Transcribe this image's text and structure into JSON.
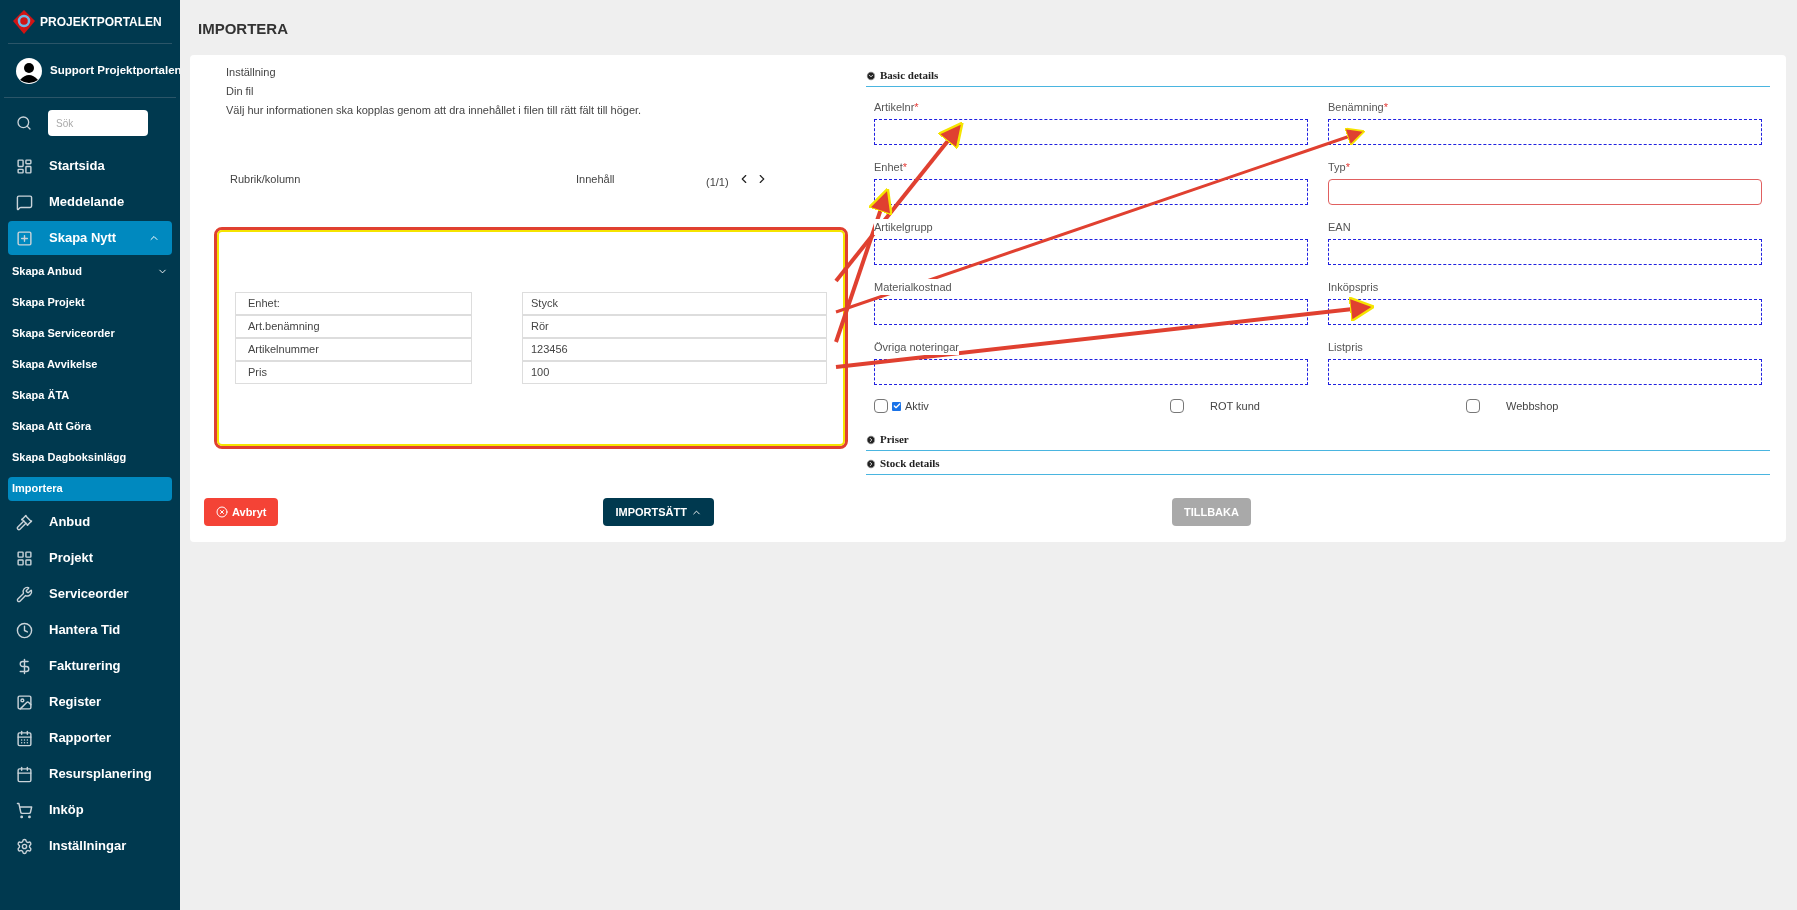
{
  "sidebar": {
    "brand": "PROJEKTPORTALEN",
    "user": "Support Projektportalen",
    "search": {
      "placeholder": "Sök"
    },
    "items": [
      {
        "label": "Startsida",
        "selected": false
      },
      {
        "label": "Meddelande",
        "selected": false
      },
      {
        "label": "Skapa Nytt",
        "selected": true,
        "expanded": true,
        "children": [
          {
            "label": "Skapa Anbud",
            "selected": false,
            "expanded": false
          },
          {
            "label": "Skapa Projekt",
            "selected": false
          },
          {
            "label": "Skapa Serviceorder",
            "selected": false
          },
          {
            "label": "Skapa Avvikelse",
            "selected": false
          },
          {
            "label": "Skapa ÄTA",
            "selected": false
          },
          {
            "label": "Skapa Att Göra",
            "selected": false
          },
          {
            "label": "Skapa Dagboksinlägg",
            "selected": false
          },
          {
            "label": "Importera",
            "selected": true
          }
        ]
      },
      {
        "label": "Anbud",
        "selected": false
      },
      {
        "label": "Projekt",
        "selected": false
      },
      {
        "label": "Serviceorder",
        "selected": false
      },
      {
        "label": "Hantera Tid",
        "selected": false
      },
      {
        "label": "Fakturering",
        "selected": false
      },
      {
        "label": "Register",
        "selected": false
      },
      {
        "label": "Rapporter",
        "selected": false
      },
      {
        "label": "Resursplanering",
        "selected": false
      },
      {
        "label": "Inköp",
        "selected": false
      },
      {
        "label": "Inställningar",
        "selected": false
      }
    ]
  },
  "page_title": "IMPORTERA",
  "intro": [
    "Inställning",
    "Din fil",
    "Välj hur informationen ska kopplas genom att dra innehållet i filen till rätt fält till höger."
  ],
  "mapping": {
    "column_heading": "Rubrik/kolumn",
    "content_heading": "Innehåll",
    "pager": "(1/1)",
    "rows": [
      {
        "heading": "Enhet:",
        "content": "Styck"
      },
      {
        "heading": "Art.benämning",
        "content": "Rör"
      },
      {
        "heading": "Artikelnummer",
        "content": "123456"
      },
      {
        "heading": "Pris",
        "content": "100"
      }
    ]
  },
  "sections": [
    {
      "title": "Basic details",
      "expanded": true,
      "fields": [
        {
          "label": "Artikelnr",
          "required_mark": "*",
          "error": false
        },
        {
          "label": "Benämning",
          "required_mark": "*",
          "error": false
        },
        {
          "label": "Enhet",
          "required_mark": "*",
          "error": false
        },
        {
          "label": "Typ",
          "required_mark": "*",
          "error": true
        },
        {
          "label": "Artikelgrupp",
          "error": false
        },
        {
          "label": "EAN",
          "error": false
        },
        {
          "label": "Materialkostnad",
          "error": false
        },
        {
          "label": "Inköpspris",
          "error": false
        },
        {
          "label": "Övriga noteringar",
          "error": false
        },
        {
          "label": "Listpris",
          "error": false
        }
      ],
      "checkboxes": [
        {
          "label": "Aktiv",
          "checked": false,
          "inner_checked": true
        },
        {
          "label": "ROT kund",
          "checked": false
        },
        {
          "label": "Webbshop",
          "checked": false
        }
      ]
    },
    {
      "title": "Priser",
      "expanded": false
    },
    {
      "title": "Stock details",
      "expanded": false
    }
  ],
  "buttons": [
    {
      "label": "Avbryt",
      "kind": "danger",
      "disabled": false
    },
    {
      "label": "IMPORTSÄTT",
      "kind": "menu",
      "disabled": false
    },
    {
      "label": "TILLBAKA",
      "kind": "plain",
      "disabled": true
    }
  ]
}
